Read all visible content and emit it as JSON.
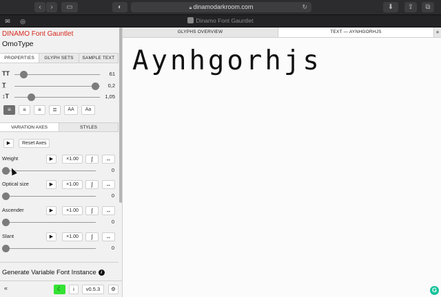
{
  "browser": {
    "url": "dinamodarkroom.com",
    "tab_title": "Dinamo Font Gauntlet"
  },
  "sidebar": {
    "app_title": "DINAMO Font Gauntlet",
    "font_name": "OmoType",
    "tabs": [
      "PROPERTIES",
      "GLYPH SETS",
      "SAMPLE TEXT"
    ],
    "properties": [
      {
        "icon": "TT",
        "value": "61",
        "fraction": 0.08
      },
      {
        "icon": "T̲",
        "value": "0,2",
        "fraction": 1.0
      },
      {
        "icon": "↕T",
        "value": "1,05",
        "fraction": 0.2
      }
    ],
    "align_buttons": [
      "align-left",
      "align-center",
      "align-right",
      "justify"
    ],
    "case_buttons": [
      "AA",
      "Aa"
    ],
    "section_tabs": [
      "VARIATION AXES",
      "STYLES"
    ],
    "reset_label": "Reset Axes",
    "axes": [
      {
        "label": "Weight",
        "rate": "×1.00",
        "value": "0"
      },
      {
        "label": "Optical size",
        "rate": "×1.00",
        "value": "0"
      },
      {
        "label": "Ascender",
        "rate": "×1.00",
        "value": "0"
      },
      {
        "label": "Slant",
        "rate": "×1.00",
        "value": "0"
      }
    ],
    "generate_label": "Generate Variable Font Instance",
    "footer": {
      "collapse": "«",
      "info": "i",
      "version": "v0.5.3",
      "settings": "⚙"
    }
  },
  "main": {
    "tabs": [
      "GLYPHS OVERVIEW",
      "TEXT — AYNHGORHJS"
    ],
    "plus": "+",
    "preview_text": "Aynhgorhjs"
  },
  "colors": {
    "accent": "#d6271c",
    "dark_toggle": "#33e233"
  }
}
